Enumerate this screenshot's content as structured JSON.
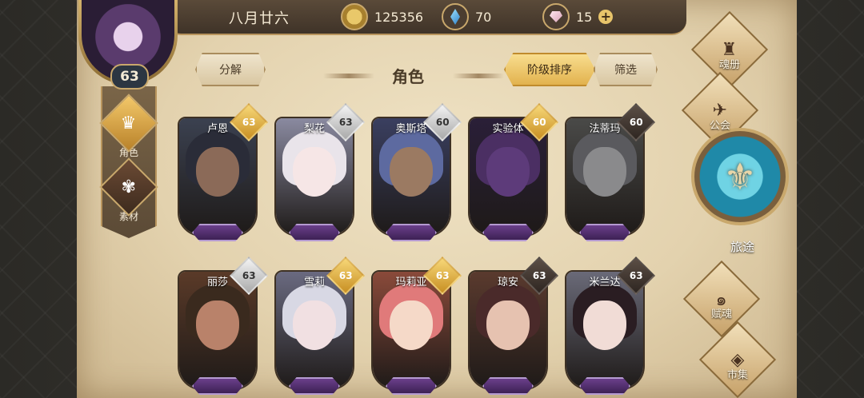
{
  "header": {
    "date": "八月廿六",
    "gold": "125356",
    "crystals": "70",
    "gems": "15"
  },
  "player": {
    "level": "63"
  },
  "sidebar": {
    "items": [
      {
        "label": "角色",
        "icon": "helmet-icon"
      },
      {
        "label": "素材",
        "icon": "creature-icon"
      }
    ]
  },
  "toolbar": {
    "decompose": "分解",
    "title": "角色",
    "sort": "阶级排序",
    "filter": "筛选"
  },
  "characters": [
    {
      "name": "卢恩",
      "level": "63",
      "tier": "gold",
      "hair": "#2a2c38",
      "skin": "#8b6a58",
      "bg": "#3b4150"
    },
    {
      "name": "梨花",
      "level": "63",
      "tier": "silver",
      "hair": "#e9e4ea",
      "skin": "#f6e6e6",
      "bg": "#8a8aa0"
    },
    {
      "name": "奥斯塔",
      "level": "60",
      "tier": "silver",
      "hair": "#5d6aa0",
      "skin": "#9b7a62",
      "bg": "#3a3f60"
    },
    {
      "name": "实验体",
      "level": "60",
      "tier": "gold",
      "hair": "#4b2f63",
      "skin": "#5d3b7a",
      "bg": "#2a1f38"
    },
    {
      "name": "法蒂玛",
      "level": "60",
      "tier": "dark",
      "hair": "#5a5a5e",
      "skin": "#8a8a8c",
      "bg": "#4a4a48"
    },
    {
      "name": "丽莎",
      "level": "63",
      "tier": "silver",
      "hair": "#3a2a1e",
      "skin": "#b9826a",
      "bg": "#5a3a28"
    },
    {
      "name": "雪莉",
      "level": "63",
      "tier": "gold",
      "hair": "#d8d8e4",
      "skin": "#f1e0e2",
      "bg": "#6a6a80"
    },
    {
      "name": "玛莉亚",
      "level": "63",
      "tier": "gold",
      "hair": "#e07a7a",
      "skin": "#f5d9c8",
      "bg": "#8a4a3a"
    },
    {
      "name": "琼安",
      "level": "63",
      "tier": "dark",
      "hair": "#4a2a2a",
      "skin": "#e6c2b0",
      "bg": "#5a3a2e"
    },
    {
      "name": "米兰达",
      "level": "63",
      "tier": "dark",
      "hair": "#2a1d22",
      "skin": "#f1dcd6",
      "bg": "#6a6a78"
    }
  ],
  "right_nav": {
    "soul_book": "魂册",
    "guild": "公会",
    "journey": "旅途",
    "endow": "赋魂",
    "market": "市集"
  }
}
